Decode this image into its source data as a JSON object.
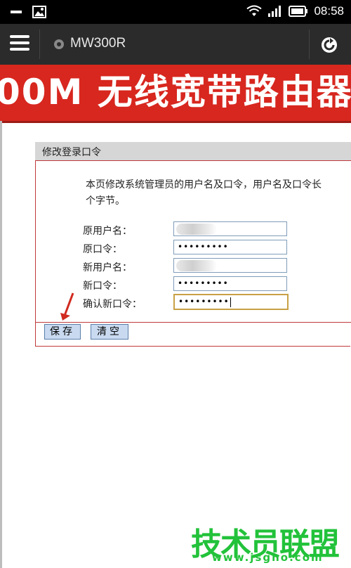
{
  "status_bar": {
    "time": "08:58",
    "icons": [
      "minus-icon",
      "image-icon",
      "wifi-icon",
      "signal-icon",
      "battery-icon"
    ]
  },
  "browser": {
    "page_title": "MW300R",
    "icons": [
      "menu-icon",
      "site-icon",
      "reload-icon"
    ]
  },
  "banner": {
    "text": "00M 无线宽带路由器",
    "color": "#d7271f"
  },
  "panel": {
    "title": "修改登录口令",
    "description_line1": "本页修改系统管理员的用户名及口令，用户名及口令长",
    "description_line2": "个字节。",
    "fields": [
      {
        "label": "原用户名：",
        "value": ""
      },
      {
        "label": "原口令：",
        "value": "•••••••••"
      },
      {
        "label": "新用户名：",
        "value": ""
      },
      {
        "label": "新口令：",
        "value": "•••••••••"
      },
      {
        "label": "确认新口令：",
        "value": "•••••••••"
      }
    ],
    "buttons": {
      "save": "保存",
      "clear": "清空"
    },
    "accent": "#c0393b"
  },
  "watermark": {
    "main": "技术员联盟",
    "url": "www.jsgho.com",
    "color": "#22c23a"
  }
}
